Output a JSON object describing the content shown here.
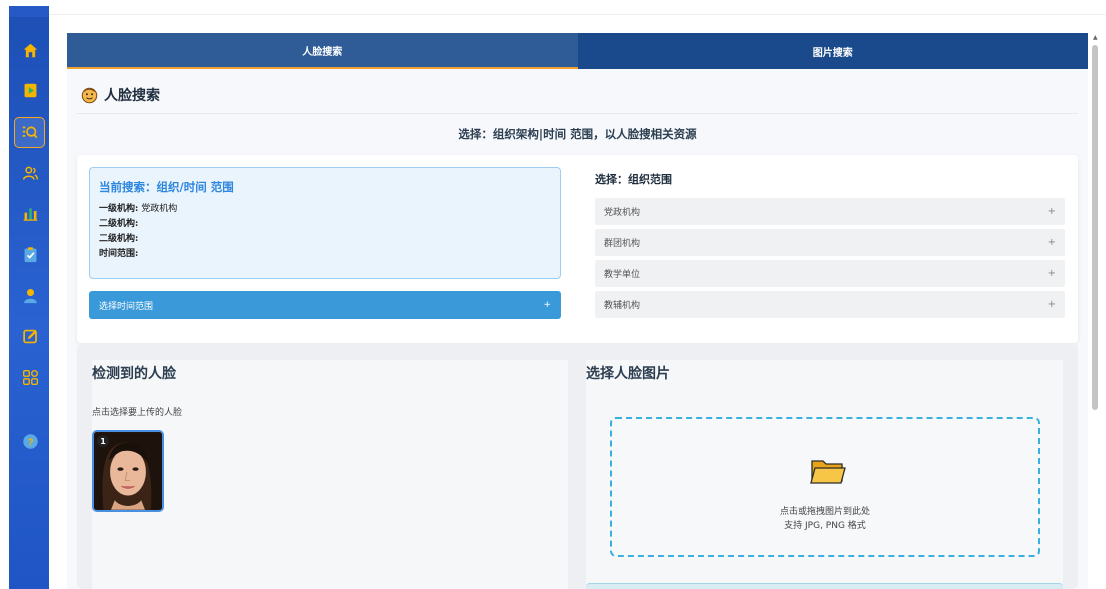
{
  "sidebar": {
    "items": [
      {
        "icon": "home-icon"
      },
      {
        "icon": "video-play-icon"
      },
      {
        "icon": "face-search-icon",
        "active": true
      },
      {
        "icon": "users-icon"
      },
      {
        "icon": "bar-chart-icon"
      },
      {
        "icon": "clipboard-check-icon"
      },
      {
        "icon": "user-icon"
      },
      {
        "icon": "edit-icon"
      },
      {
        "icon": "apps-grid-icon"
      },
      {
        "icon": "help-icon"
      }
    ]
  },
  "tabs": [
    {
      "label": "人脸搜索",
      "active": true
    },
    {
      "label": "图片搜索",
      "active": false
    }
  ],
  "section": {
    "title": "人脸搜索"
  },
  "instruction": "选择：组织架构|时间 范围，以人脸搜相关资源",
  "current_search": {
    "title": "当前搜索：组织/时间 范围",
    "fields": [
      {
        "label": "一级机构:",
        "value": "党政机构"
      },
      {
        "label": "二级机构:",
        "value": ""
      },
      {
        "label": "二级机构:",
        "value": ""
      },
      {
        "label": "时间范围:",
        "value": ""
      }
    ]
  },
  "time_range_button": {
    "label": "选择时间范围",
    "icon": "+"
  },
  "org_select": {
    "title": "选择：组织范围",
    "items": [
      "党政机构",
      "群团机构",
      "教学单位",
      "教辅机构"
    ],
    "expand_icon": "+"
  },
  "faces_panel": {
    "title": "检测到的人脸",
    "hint": "点击选择要上传的人脸",
    "faces": [
      {
        "badge": "1"
      }
    ]
  },
  "upload_panel": {
    "title": "选择人脸图片",
    "drop_line1": "点击或拖拽图片到此处",
    "drop_line2": "支持 JPG, PNG 格式"
  },
  "colors": {
    "tab_active": "#2f5b97",
    "tab_inactive": "#1a4a8c",
    "accent": "#f0a030",
    "primary_button": "#3a9ad9",
    "current_title": "#2e86de"
  }
}
